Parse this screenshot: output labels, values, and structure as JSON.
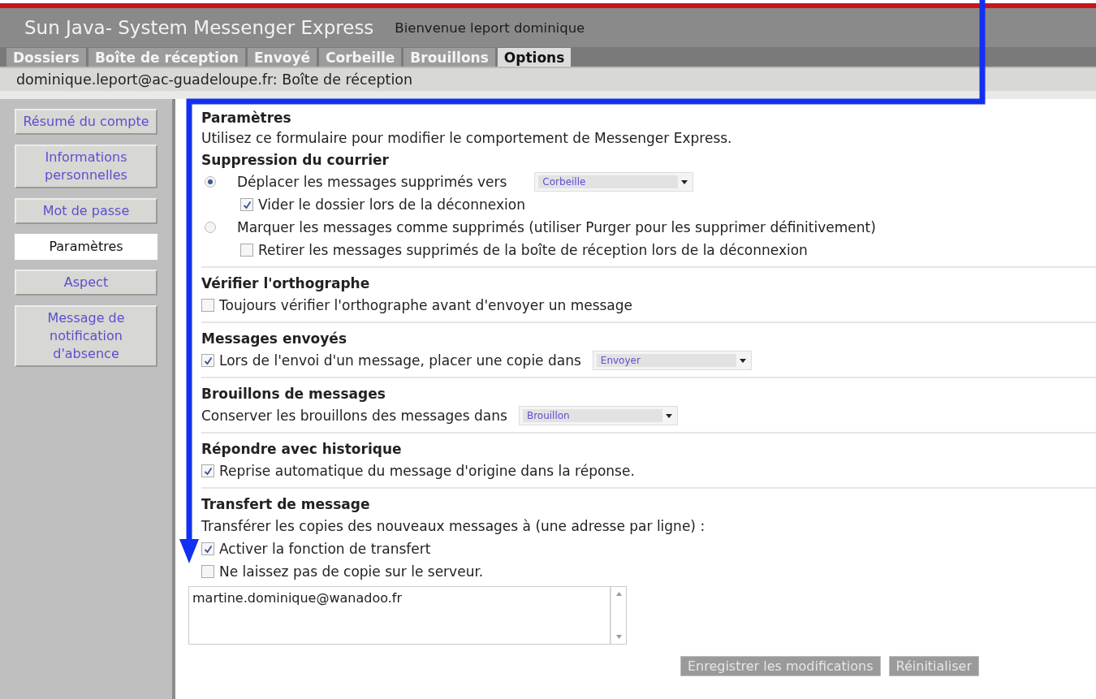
{
  "header": {
    "title": "Sun Java- System Messenger Express",
    "welcome": "Bienvenue leport dominique"
  },
  "tabs": [
    {
      "label": "Dossiers",
      "selected": false
    },
    {
      "label": "Boîte de réception",
      "selected": false
    },
    {
      "label": "Envoyé",
      "selected": false
    },
    {
      "label": "Corbeille",
      "selected": false
    },
    {
      "label": "Brouillons",
      "selected": false
    },
    {
      "label": "Options",
      "selected": true
    }
  ],
  "account_line": "dominique.leport@ac-guadeloupe.fr: Boîte de réception",
  "sidebar": {
    "items": [
      {
        "label": "Résumé du compte",
        "selected": false
      },
      {
        "label": "Informations personnelles",
        "selected": false
      },
      {
        "label": "Mot de passe",
        "selected": false
      },
      {
        "label": "Paramètres",
        "selected": true
      },
      {
        "label": "Aspect",
        "selected": false
      },
      {
        "label": "Message de notification d'absence",
        "selected": false
      }
    ]
  },
  "settings": {
    "title": "Paramètres",
    "description": "Utilisez ce formulaire pour modifier le comportement de Messenger Express.",
    "sections": [
      {
        "heading": "Suppression du courrier",
        "rows": [
          {
            "kind": "radio",
            "label": "Déplacer les messages supprimés vers",
            "selected": true,
            "select": "Corbeille"
          },
          {
            "kind": "checkbox",
            "label": "Vider le dossier lors de la déconnexion",
            "checked": true,
            "indented": true
          },
          {
            "kind": "radio",
            "label": "Marquer les messages comme supprimés (utiliser Purger pour les supprimer définitivement)",
            "selected": false
          },
          {
            "kind": "checkbox",
            "label": "Retirer les messages supprimés de la boîte de réception lors de la déconnexion",
            "checked": false,
            "indented": true
          }
        ]
      },
      {
        "heading": "Vérifier l'orthographe",
        "rows": [
          {
            "kind": "checkbox",
            "label": "Toujours vérifier l'orthographe avant d'envoyer un message",
            "checked": false
          }
        ]
      },
      {
        "heading": "Messages envoyés",
        "rows": [
          {
            "kind": "checkbox",
            "label": "Lors de l'envoi d'un message, placer une copie dans",
            "checked": true,
            "select": "Envoyer"
          }
        ]
      },
      {
        "heading": "Brouillons de messages",
        "rows": [
          {
            "kind": "text",
            "label": "Conserver les brouillons des messages dans",
            "select": "Brouillon"
          }
        ]
      },
      {
        "heading": "Répondre avec historique",
        "rows": [
          {
            "kind": "checkbox",
            "label": "Reprise automatique du message d'origine dans la réponse.",
            "checked": true
          }
        ]
      },
      {
        "heading": "Transfert de message",
        "rows": [
          {
            "kind": "text",
            "label": "Transférer les copies des nouveaux messages à (une adresse par ligne) :"
          },
          {
            "kind": "checkbox",
            "label": "Activer la fonction de transfert",
            "checked": true
          },
          {
            "kind": "checkbox",
            "label": "Ne laissez pas de copie sur le serveur.",
            "checked": false
          },
          {
            "kind": "textarea",
            "value": "martine.dominique@wanadoo.fr"
          }
        ]
      }
    ]
  },
  "buttons": [
    "Enregistrer les modifications",
    "Réinitialiser"
  ]
}
